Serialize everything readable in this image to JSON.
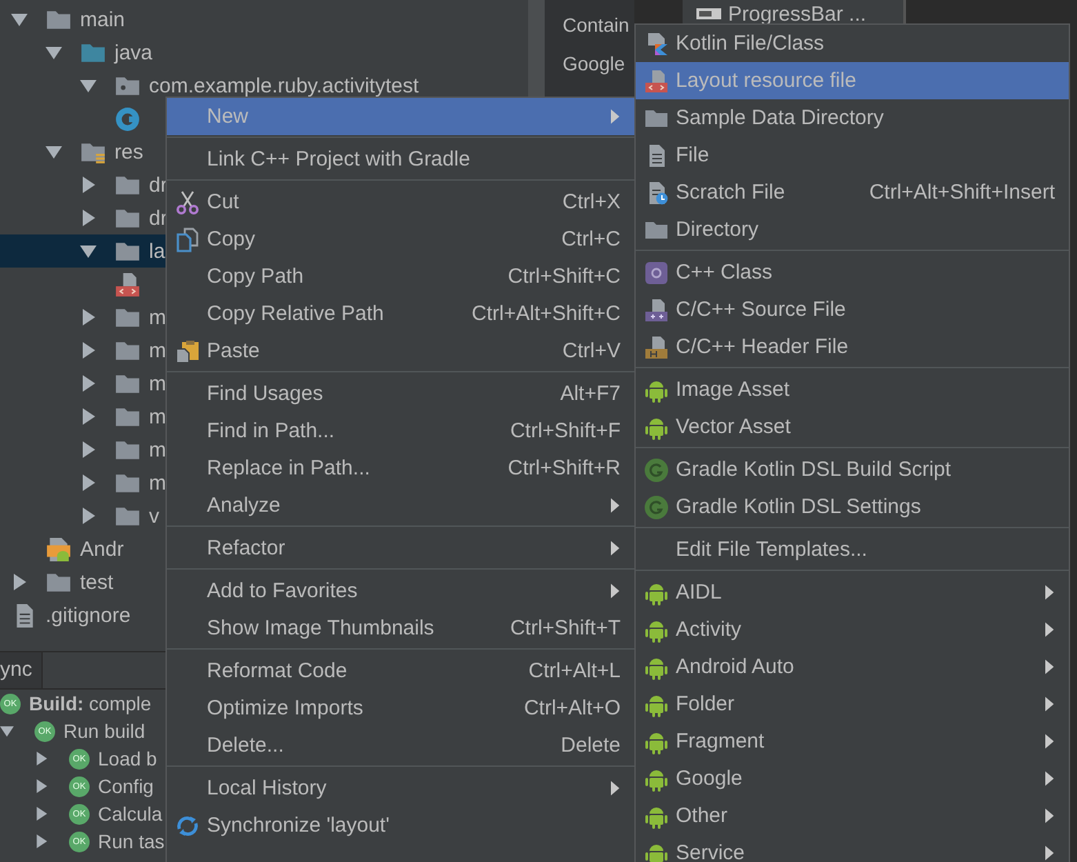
{
  "project_tree": [
    {
      "label": "main",
      "kind": "folder",
      "expanded": true,
      "selected": false,
      "children": [
        {
          "label": "java",
          "kind": "source-folder",
          "expanded": true,
          "selected": false,
          "children": [
            {
              "label": "com.example.ruby.activitytest",
              "kind": "package",
              "expanded": true,
              "selected": false,
              "children": [
                {
                  "kind": "class",
                  "selected": false
                }
              ]
            }
          ]
        },
        {
          "label": "res",
          "kind": "res-folder",
          "expanded": true,
          "selected": false,
          "children": [
            {
              "label": "dr",
              "kind": "folder",
              "expanded": false,
              "selected": false
            },
            {
              "label": "dr",
              "kind": "folder",
              "expanded": false,
              "selected": false
            },
            {
              "label": "la",
              "kind": "folder",
              "expanded": true,
              "selected": true,
              "children": [
                {
                  "kind": "layout-file",
                  "selected": false
                }
              ]
            },
            {
              "label": "m",
              "kind": "folder",
              "expanded": false,
              "selected": false
            },
            {
              "label": "m",
              "kind": "folder",
              "expanded": false,
              "selected": false
            },
            {
              "label": "m",
              "kind": "folder",
              "expanded": false,
              "selected": false
            },
            {
              "label": "m",
              "kind": "folder",
              "expanded": false,
              "selected": false
            },
            {
              "label": "m",
              "kind": "folder",
              "expanded": false,
              "selected": false
            },
            {
              "label": "m",
              "kind": "folder",
              "expanded": false,
              "selected": false
            },
            {
              "label": "v",
              "kind": "folder",
              "expanded": false,
              "selected": false
            }
          ]
        },
        {
          "label": "Andr",
          "kind": "manifest",
          "selected": false
        }
      ]
    },
    {
      "label": "test",
      "kind": "folder",
      "expanded": false,
      "selected": false
    },
    {
      "label": ".gitignore",
      "kind": "file",
      "selected": false
    }
  ],
  "palette": {
    "items": [
      "Contain",
      "Google"
    ]
  },
  "editor": {
    "component": "ProgressBar ..."
  },
  "build_panel": {
    "tab": "ync",
    "rows": [
      {
        "title": "**Build:** comple",
        "status": "OK"
      },
      {
        "title": "Run build",
        "status": "OK",
        "expanded": true,
        "children": [
          {
            "title": "Load b",
            "status": "OK",
            "expanded": false
          },
          {
            "title": "Config",
            "status": "OK",
            "expanded": false
          },
          {
            "title": "Calcula",
            "status": "OK",
            "expanded": false
          },
          {
            "title": "Run tas",
            "status": "OK",
            "expanded": false
          }
        ]
      }
    ]
  },
  "context_menu": {
    "groups": [
      [
        {
          "label": "New",
          "selected": true,
          "has_submenu": true
        }
      ],
      [
        {
          "label": "Link C++ Project with Gradle",
          "selected": false
        }
      ],
      [
        {
          "label": "Cut",
          "kind": "scissors",
          "shortcut": "Ctrl+X",
          "selected": false
        },
        {
          "label": "Copy",
          "kind": "copy",
          "shortcut": "Ctrl+C",
          "selected": false
        },
        {
          "label": "Copy Path",
          "shortcut": "Ctrl+Shift+C",
          "selected": false
        },
        {
          "label": "Copy Relative Path",
          "shortcut": "Ctrl+Alt+Shift+C",
          "selected": false
        },
        {
          "label": "Paste",
          "kind": "clipboard",
          "shortcut": "Ctrl+V",
          "selected": false
        }
      ],
      [
        {
          "label": "Find Usages",
          "shortcut": "Alt+F7",
          "selected": false
        },
        {
          "label": "Find in Path...",
          "shortcut": "Ctrl+Shift+F",
          "selected": false
        },
        {
          "label": "Replace in Path...",
          "shortcut": "Ctrl+Shift+R",
          "selected": false
        },
        {
          "label": "Analyze",
          "selected": false,
          "has_submenu": true
        }
      ],
      [
        {
          "label": "Refactor",
          "selected": false,
          "has_submenu": true
        }
      ],
      [
        {
          "label": "Add to Favorites",
          "selected": false,
          "has_submenu": true
        },
        {
          "label": "Show Image Thumbnails",
          "shortcut": "Ctrl+Shift+T",
          "selected": false
        }
      ],
      [
        {
          "label": "Reformat Code",
          "shortcut": "Ctrl+Alt+L",
          "selected": false
        },
        {
          "label": "Optimize Imports",
          "shortcut": "Ctrl+Alt+O",
          "selected": false
        },
        {
          "label": "Delete...",
          "shortcut": "Delete",
          "selected": false
        }
      ],
      [
        {
          "label": "Local History",
          "selected": false,
          "has_submenu": true
        },
        {
          "label": "Synchronize 'layout'",
          "kind": "sync",
          "selected": false
        }
      ]
    ]
  },
  "new_submenu": {
    "groups": [
      [
        {
          "label": "Kotlin File/Class",
          "kind": "kotlin",
          "selected": false
        },
        {
          "label": "Layout resource file",
          "kind": "layout-file",
          "selected": true
        },
        {
          "label": "Sample Data Directory",
          "kind": "folder",
          "selected": false
        },
        {
          "label": "File",
          "kind": "file",
          "selected": false
        },
        {
          "label": "Scratch File",
          "kind": "scratch",
          "shortcut": "Ctrl+Alt+Shift+Insert",
          "selected": false
        },
        {
          "label": "Directory",
          "kind": "folder",
          "selected": false
        }
      ],
      [
        {
          "label": "C++ Class",
          "kind": "cpp-class",
          "selected": false
        },
        {
          "label": "C/C++ Source File",
          "kind": "cpp-source",
          "selected": false
        },
        {
          "label": "C/C++ Header File",
          "kind": "cpp-header",
          "selected": false
        }
      ],
      [
        {
          "label": "Image Asset",
          "kind": "android",
          "selected": false
        },
        {
          "label": "Vector Asset",
          "kind": "android",
          "selected": false
        }
      ],
      [
        {
          "label": "Gradle Kotlin DSL Build Script",
          "kind": "gradle",
          "selected": false
        },
        {
          "label": "Gradle Kotlin DSL Settings",
          "kind": "gradle",
          "selected": false
        }
      ],
      [
        {
          "label": "Edit File Templates...",
          "selected": false
        }
      ],
      [
        {
          "label": "AIDL",
          "kind": "android",
          "selected": false,
          "has_submenu": true
        },
        {
          "label": "Activity",
          "kind": "android",
          "selected": false,
          "has_submenu": true
        },
        {
          "label": "Android Auto",
          "kind": "android",
          "selected": false,
          "has_submenu": true
        },
        {
          "label": "Folder",
          "kind": "android",
          "selected": false,
          "has_submenu": true
        },
        {
          "label": "Fragment",
          "kind": "android",
          "selected": false,
          "has_submenu": true
        },
        {
          "label": "Google",
          "kind": "android",
          "selected": false,
          "has_submenu": true
        },
        {
          "label": "Other",
          "kind": "android",
          "selected": false,
          "has_submenu": true
        },
        {
          "label": "Service",
          "kind": "android",
          "selected": false,
          "has_submenu": true
        }
      ]
    ]
  }
}
